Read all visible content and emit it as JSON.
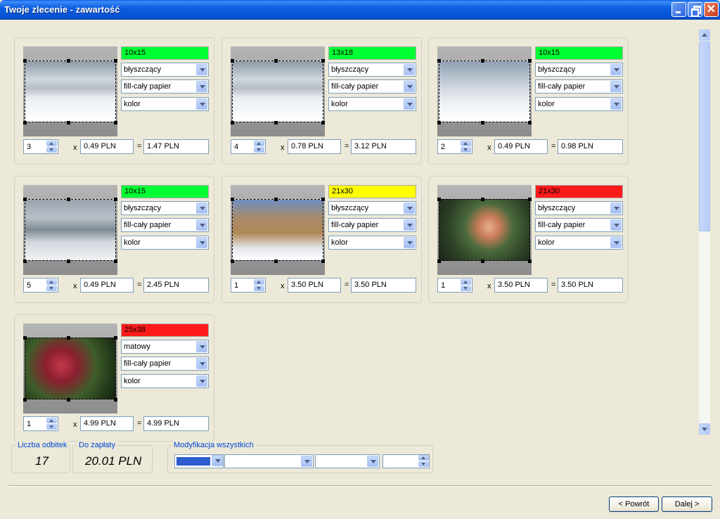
{
  "window": {
    "title": "Twoje zlecenie - zawartość"
  },
  "items": [
    {
      "size": "10x15",
      "size_color": "#00ff33",
      "finish": "błyszczący",
      "fit": "fill-cały papier",
      "color_mode": "kolor",
      "qty": "3",
      "unit_price": "0.49 PLN",
      "total": "1.47 PLN",
      "photo_icon": "car-snow-photo"
    },
    {
      "size": "13x18",
      "size_color": "#00ff33",
      "finish": "błyszczący",
      "fit": "fill-cały papier",
      "color_mode": "kolor",
      "qty": "4",
      "unit_price": "0.78 PLN",
      "total": "3.12 PLN",
      "photo_icon": "car-snow-photo"
    },
    {
      "size": "10x15",
      "size_color": "#00ff33",
      "finish": "błyszczący",
      "fit": "fill-cały papier",
      "color_mode": "kolor",
      "qty": "2",
      "unit_price": "0.49 PLN",
      "total": "0.98 PLN",
      "photo_icon": "snow-field-photo"
    },
    {
      "size": "10x15",
      "size_color": "#00ff33",
      "finish": "błyszczący",
      "fit": "fill-cały papier",
      "color_mode": "kolor",
      "qty": "5",
      "unit_price": "0.49 PLN",
      "total": "2.45 PLN",
      "photo_icon": "snow-hills-photo"
    },
    {
      "size": "21x30",
      "size_color": "#ffff00",
      "finish": "błyszczący",
      "fit": "fill-cały papier",
      "color_mode": "kolor",
      "qty": "1",
      "unit_price": "3.50 PLN",
      "total": "3.50 PLN",
      "photo_icon": "snow-trees-photo"
    },
    {
      "size": "21x30",
      "size_color": "#ff1a1a",
      "finish": "błyszczący",
      "fit": "fill-cały papier",
      "color_mode": "kolor",
      "qty": "1",
      "unit_price": "3.50 PLN",
      "total": "3.50 PLN",
      "photo_icon": "rose-photo"
    },
    {
      "size": "25x38",
      "size_color": "#ff1a1a",
      "finish": "matowy",
      "fit": "fill-cały papier",
      "color_mode": "kolor",
      "qty": "1",
      "unit_price": "4.99 PLN",
      "total": "4.99 PLN",
      "photo_icon": "red-roses-photo"
    }
  ],
  "labels": {
    "times": "x",
    "equals": "="
  },
  "summary": {
    "count_label": "Liczba odbitek",
    "count_value": "17",
    "pay_label": "Do zapłaty",
    "pay_value": "20.01 PLN",
    "modify_label": "Modyfikacja wszystkich"
  },
  "buttons": {
    "back": "< Powrót",
    "next": "Dalej >"
  }
}
